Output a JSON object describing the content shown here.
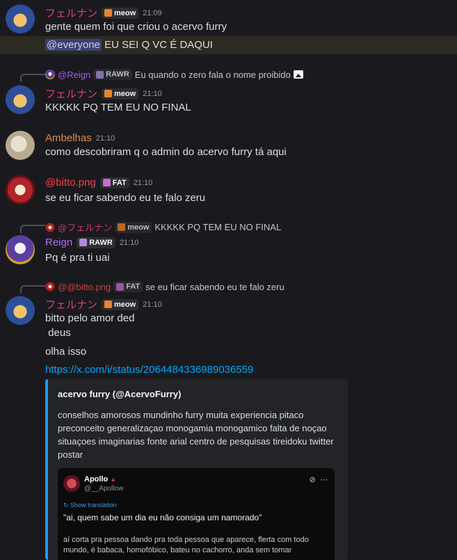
{
  "colors": {
    "background": "#1a1a1e",
    "link": "#00a8fc",
    "fernan": "#e23f7a",
    "ambelhas": "#e0884a",
    "bitto": "#f04545",
    "reign": "#b06bff",
    "embed_border": "#1d9bf0"
  },
  "messages": [
    {
      "author": "フェルナン",
      "tag": "meow",
      "time": "21:09",
      "lines": [
        "gente quem foi que criou o acervo furry"
      ],
      "mention_line": {
        "mention": "@everyone",
        "text": " EU SEI Q VC É DAQUI"
      }
    },
    {
      "reply": {
        "author": "@Reign",
        "tag": "RAWR",
        "text": "Eu quando o zero fala o nome proibido",
        "icon": "image-icon"
      },
      "author": "フェルナン",
      "tag": "meow",
      "time": "21:10",
      "lines": [
        "KKKKK PQ TEM EU NO FINAL"
      ]
    },
    {
      "author": "Ambelhas",
      "time": "21:10",
      "lines": [
        "como descobriram q o admin do acervo furry tá aqui"
      ]
    },
    {
      "author": "@bitto.png",
      "tag": "FAT",
      "time": "21:10",
      "lines": [
        "se eu ficar sabendo eu te falo zeru"
      ]
    },
    {
      "reply": {
        "author": "@フェルナン",
        "tag": "meow",
        "text": "KKKKK PQ TEM EU NO FINAL"
      },
      "author": "Reign",
      "tag": "RAWR",
      "time": "21:10",
      "lines": [
        "Pq é pra ti uai"
      ]
    },
    {
      "reply": {
        "author": "@@bitto.png",
        "tag": "FAT",
        "text": "se eu ficar sabendo eu te falo zeru"
      },
      "author": "フェルナン",
      "tag": "meow",
      "time": "21:10",
      "lines": [
        "bitto pelo amor ded",
        " deus",
        "olha isso"
      ],
      "link": "https://x.com/i/status/2064484336989036559"
    }
  ],
  "embed": {
    "author": "acervo furry (@AcervoFurry)",
    "description": "conselhos amorosos mundinho furry muita experiencia pitaco preconceito generalizaçao monogamia monogamico falta de noçao situaçoes imaginarias fonte arial centro de pesquisas tireidoku twitter postar",
    "tweet": {
      "name": "Apollo",
      "handle": "@__Apollow",
      "translate": "Show translation",
      "quote": "\"ai, quem sabe um dia eu não consiga um namorado\"",
      "body": "aí corta pra pessoa dando pra toda pessoa que aparece, flerta com todo mundo, é babaca, homofóbico, bateu no cachorro, anda sem tomar"
    }
  }
}
